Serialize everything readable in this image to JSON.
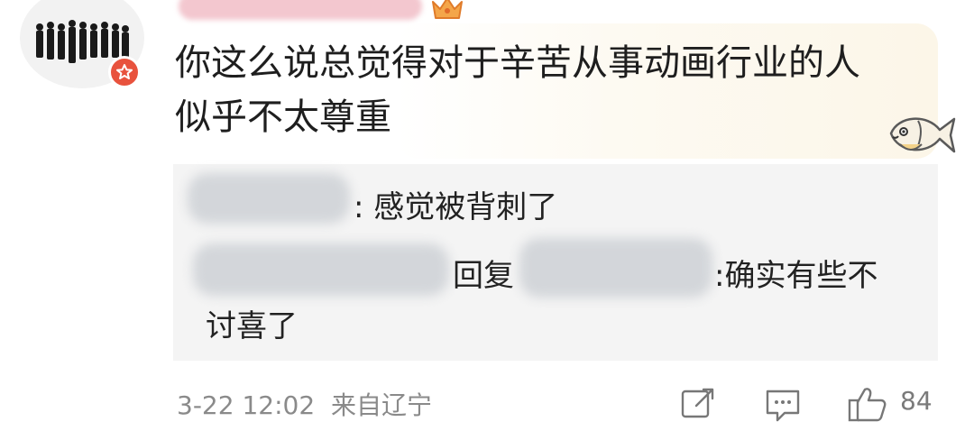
{
  "comment": {
    "text_line1": "你这么说总觉得对于辛苦从事动画行业的人",
    "text_line2": "似乎不太尊重"
  },
  "replies": [
    {
      "text": ": 感觉被背刺了"
    },
    {
      "reply_word": "回复",
      "text_part1": ":确实有些不",
      "text_part2": "讨喜了"
    }
  ],
  "footer": {
    "timestamp": "3-22 12:02",
    "source": "来自辽宁",
    "like_count": "84"
  },
  "icons": {
    "avatar": "group-photo-avatar",
    "verified": "verified-badge-icon",
    "crown": "crown-icon",
    "fish": "fish-sticker-icon",
    "share": "share-icon",
    "comment": "comment-icon",
    "like": "thumbs-up-icon"
  },
  "colors": {
    "badge": "#e8523d",
    "meta_text": "#8a8a8a",
    "reply_bg": "#f4f4f4"
  }
}
